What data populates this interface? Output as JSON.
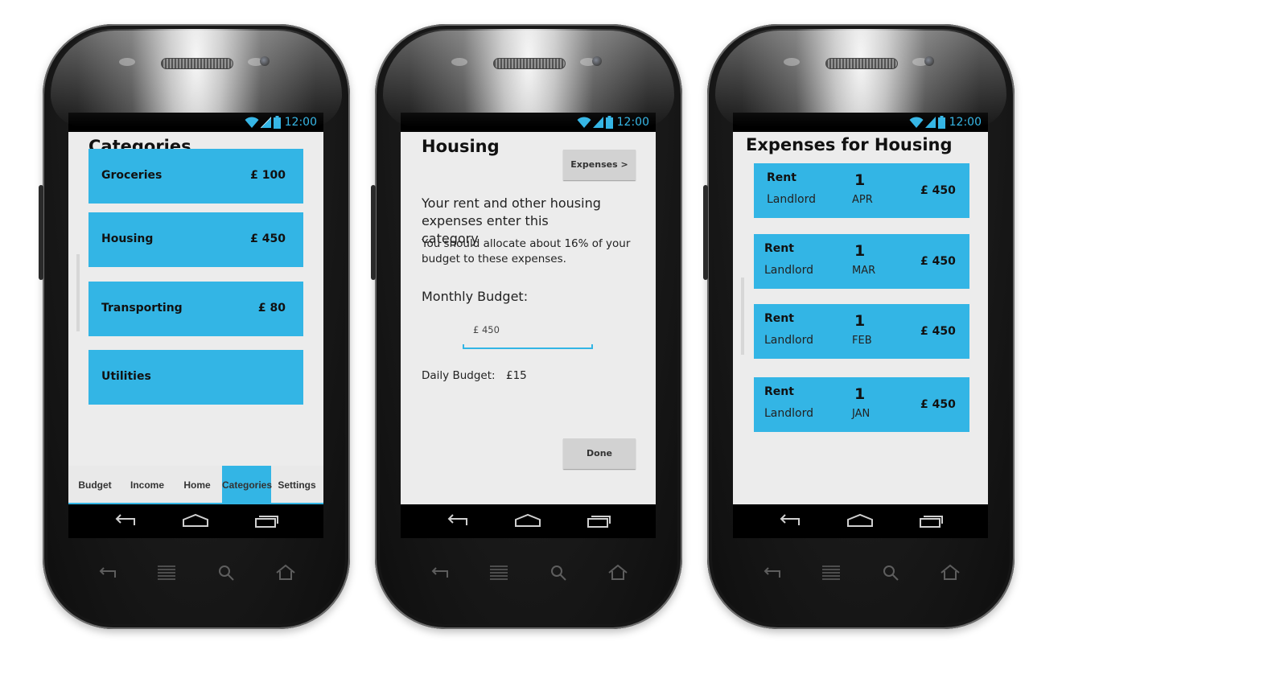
{
  "status_time": "12:00",
  "accent_color": "#33b5e5",
  "screen1": {
    "title": "Categories",
    "categories": [
      {
        "name": "Groceries",
        "amount": "£ 100"
      },
      {
        "name": "Housing",
        "amount": "£ 450"
      },
      {
        "name": "Transporting",
        "amount": "£ 80"
      },
      {
        "name": "Utilities",
        "amount": ""
      }
    ],
    "tabs": [
      {
        "label": "Budget",
        "active": false
      },
      {
        "label": "Income",
        "active": false
      },
      {
        "label": "Home",
        "active": false
      },
      {
        "label": "Categories",
        "active": true
      },
      {
        "label": "Settings",
        "active": false
      }
    ]
  },
  "screen2": {
    "title": "Housing",
    "expenses_button": "Expenses >",
    "description": "Your rent and other housing expenses enter this category",
    "advice": "You should allocate about 16% of your budget to these expenses.",
    "monthly_budget_label": "Monthly Budget:",
    "monthly_budget_value": "£ 450",
    "daily_budget_label": "Daily Budget:",
    "daily_budget_value": "£15",
    "done_button": "Done"
  },
  "screen3": {
    "title": "Expenses for Housing",
    "expenses": [
      {
        "title": "Rent",
        "payee": "Landlord",
        "day": "1",
        "month": "APR",
        "amount": "£ 450"
      },
      {
        "title": "Rent",
        "payee": "Landlord",
        "day": "1",
        "month": "MAR",
        "amount": "£ 450"
      },
      {
        "title": "Rent",
        "payee": "Landlord",
        "day": "1",
        "month": "FEB",
        "amount": "£ 450"
      },
      {
        "title": "Rent",
        "payee": "Landlord",
        "day": "1",
        "month": "JAN",
        "amount": "£ 450"
      }
    ]
  },
  "icons": {
    "wifi": "wifi-icon",
    "signal": "signal-icon",
    "battery": "battery-icon",
    "back": "back-icon",
    "home": "home-icon",
    "recents": "recents-icon"
  }
}
